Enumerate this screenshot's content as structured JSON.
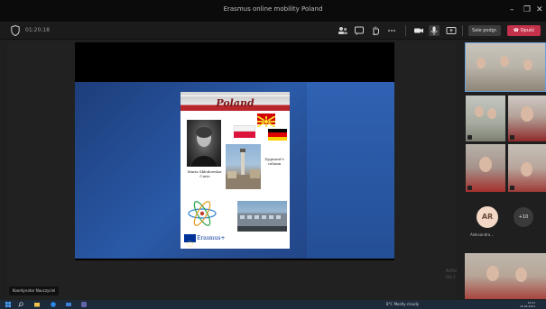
{
  "window": {
    "title": "Erasmus online mobility Poland",
    "minimize": "–",
    "restore": "❐",
    "close": "✕"
  },
  "toolbar": {
    "timer": "01:20:18",
    "ghost_label": "",
    "breakout_rooms_label": "Sale podgr.",
    "leave_label": "Opuść",
    "accent": "#c4314b"
  },
  "slide": {
    "title": "Poland",
    "curie_caption": "Maria Skłodowska-Curie",
    "column_caption": "Zygmunt's column",
    "erasmus_label": "Erasmus+"
  },
  "stage": {
    "presenter_label": "Koordynator Nauczyciel"
  },
  "participants": {
    "avatar_initials": "AR",
    "avatar_name": "Aleksandra...",
    "more_label": "+10"
  },
  "watermark": {
    "line1": "Activ",
    "line2": "Go t"
  },
  "taskbar": {
    "tray_text": "8°C Mostly cloudy",
    "time": "10:21",
    "date": "16.04.2021"
  }
}
